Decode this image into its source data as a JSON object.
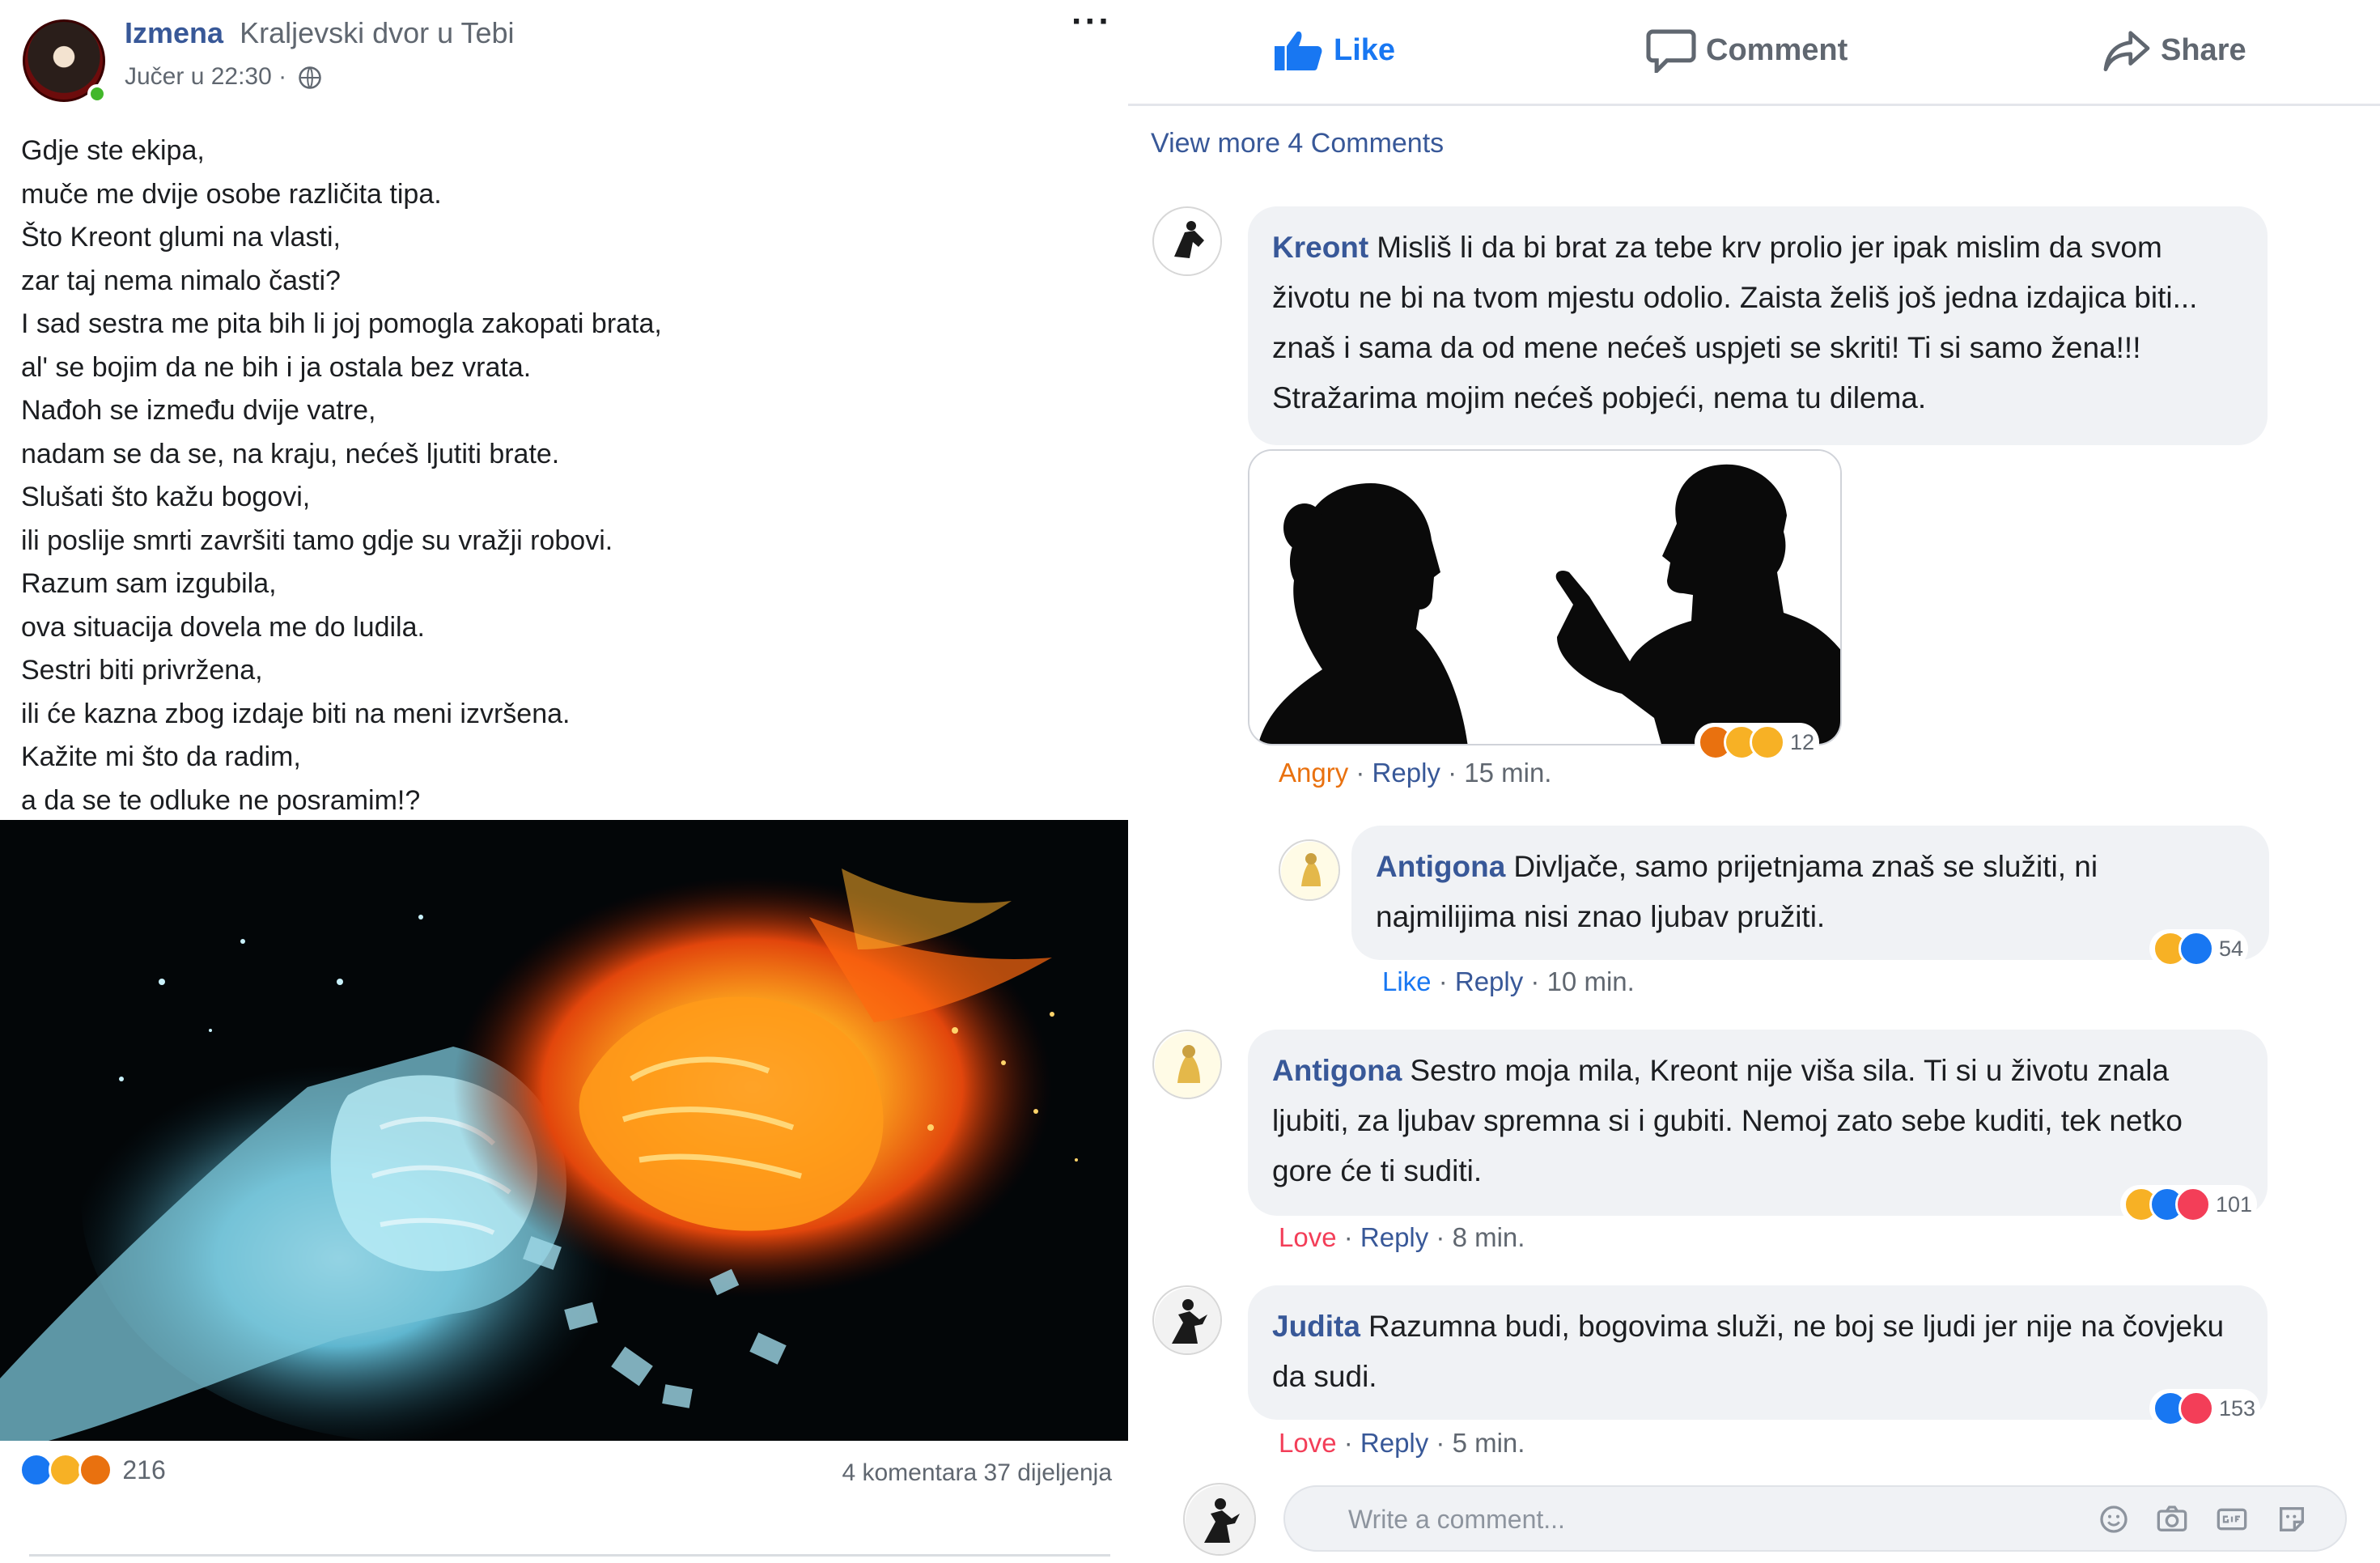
{
  "post": {
    "page_name": "Izmena",
    "group_name": "Kraljevski dvor u Tebi",
    "timestamp": "Jučer u 22:30 ·",
    "more_label": "···",
    "poem_lines": [
      "Gdje ste ekipa,",
      "muče me dvije osobe različita tipa.",
      "Što Kreont glumi na vlasti,",
      "zar taj nema nimalo časti?",
      "I sad sestra me pita bih li joj pomogla zakopati brata,",
      "al' se bojim da ne bih i ja ostala bez vrata.",
      "Nađoh se između dvije vatre,",
      "nadam se da se, na kraju, nećeš ljutiti brate.",
      "Slušati što kažu bogovi,",
      "ili poslije smrti završiti tamo gdje su vražji robovi.",
      "Razum sam izgubila,",
      "ova situacija dovela me do ludila.",
      "Sestri biti privržena,",
      "ili će kazna zbog izdaje biti na meni izvršena.",
      "Kažite mi što da radim,",
      "a da se te odluke ne posramim!?"
    ],
    "reactions": [
      "like-icon",
      "sad-icon",
      "angry-icon"
    ],
    "reaction_count": "216",
    "counts": "4 komentara 37 dijeljenja"
  },
  "actions": {
    "like": "Like",
    "comment": "Comment",
    "share": "Share"
  },
  "view_more": "View more 4 Comments",
  "comments": [
    {
      "author": "Kreont",
      "text": "Misliš li da bi brat za tebe krv prolio jer ipak mislim da svom životu ne bi na tvom mjestu odolio. Zaista želiš još jedna izdajica biti... znaš i sama da od mene nećeš uspjeti se skriti! Ti si samo žena!!! Stražarima mojim nećeš pobjeći, nema tu dilema.",
      "reaction_label": "Angry",
      "reply_label": "Reply",
      "time": "15 min.",
      "reactions": [
        "angry-icon",
        "sad-icon",
        "wow-icon"
      ],
      "reaction_count": "12"
    },
    {
      "author": "Antigona",
      "text": "Divljače, samo prijetnjama znaš se služiti, ni najmilijima nisi znao ljubav pružiti.",
      "reaction_label": "Like",
      "reply_label": "Reply",
      "time": "10 min.",
      "reactions": [
        "wow-icon",
        "like-icon"
      ],
      "reaction_count": "54"
    },
    {
      "author": "Antigona",
      "text": "Sestro moja mila, Kreont nije viša sila. Ti si u životu znala ljubiti, za ljubav spremna si i gubiti. Nemoj zato sebe kuditi, tek netko gore će ti suditi.",
      "reaction_label": "Love",
      "reply_label": "Reply",
      "time": "8 min.",
      "reactions": [
        "wow-icon",
        "like-icon",
        "love-icon"
      ],
      "reaction_count": "101"
    },
    {
      "author": "Judita",
      "text": "Razumna budi, bogovima služi, ne boj se ljudi jer nije na čovjeku da sudi.",
      "reaction_label": "Love",
      "reply_label": "Reply",
      "time": "5 min.",
      "reactions": [
        "like-icon",
        "love-icon"
      ],
      "reaction_count": "153"
    }
  ],
  "composer": {
    "placeholder": "Write a comment...",
    "icons": [
      "emoji-icon",
      "camera-icon",
      "gif-icon",
      "sticker-icon"
    ]
  },
  "colors": {
    "link_blue": "#385898",
    "like_blue": "#1877f2",
    "angry_orange": "#e9710f",
    "love_red": "#f33e58",
    "bubble_gray": "#f0f2f5",
    "meta_gray": "#606770"
  }
}
